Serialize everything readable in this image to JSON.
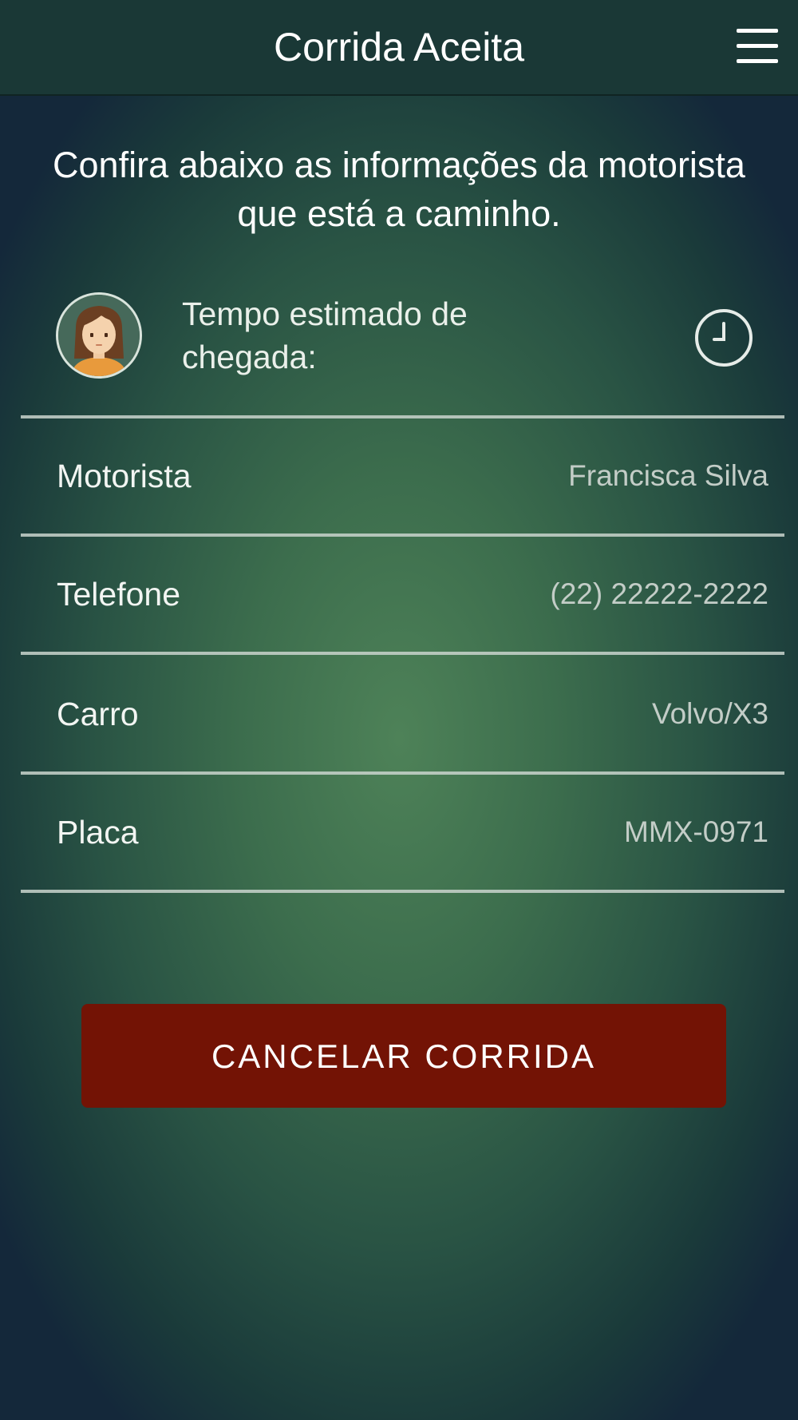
{
  "header": {
    "title": "Corrida Aceita",
    "menu_icon": "hamburger-menu-icon"
  },
  "intro": {
    "text": "Confira abaixo as informações da motorista que está a caminho."
  },
  "eta": {
    "label": "Tempo estimado de chegada:",
    "icon": "clock-icon"
  },
  "driver_info": {
    "rows": [
      {
        "label": "Motorista",
        "value": "Francisca Silva"
      },
      {
        "label": "Telefone",
        "value": "(22) 22222-2222"
      },
      {
        "label": "Carro",
        "value": "Volvo/X3"
      },
      {
        "label": "Placa",
        "value": "MMX-0971"
      }
    ]
  },
  "actions": {
    "cancel_label": "CANCELAR CORRIDA"
  },
  "colors": {
    "header_bg": "#1a3836",
    "background_center": "#4e8258",
    "background_edge": "#14283a",
    "cancel_button": "#731305",
    "divider": "#c9d3cd"
  }
}
